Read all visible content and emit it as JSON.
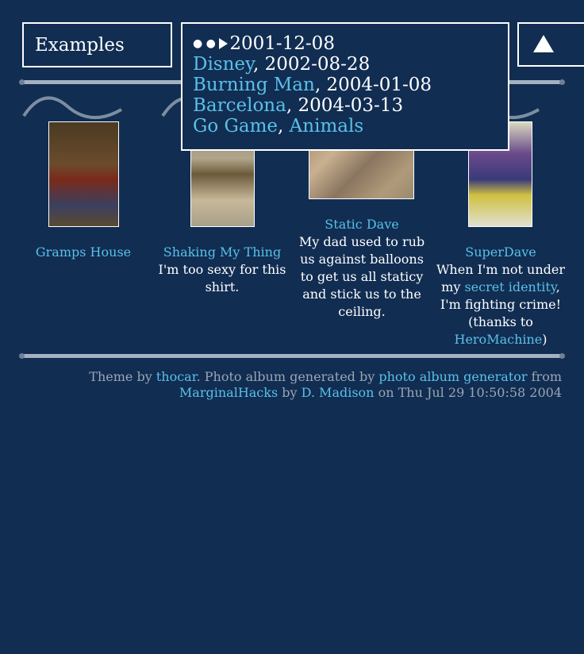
{
  "header": {
    "title": "Examples",
    "current_date": "2001-12-08",
    "nav": [
      {
        "link": "Disney",
        "date": ", 2002-08-28"
      },
      {
        "link": "Burning Man",
        "date": ", 2004-01-08"
      },
      {
        "link": "Barcelona",
        "date": ", 2004-03-13"
      }
    ],
    "other_links": [
      "Go Game",
      "Animals"
    ],
    "up_icon": "up-triangle-icon"
  },
  "albums": [
    {
      "name": "Gramps House",
      "desc": ""
    },
    {
      "name": "Shaking My Thing",
      "desc": "I'm too sexy for this shirt."
    },
    {
      "name": "Static Dave",
      "desc": "My dad used to rub us against balloons to get us all staticy and stick us to the ceiling."
    },
    {
      "name": "SuperDave",
      "desc_pre": "When I'm not under my ",
      "desc_link": "secret identity",
      "desc_mid": ", I'm fighting crime! (thanks to ",
      "desc_link2": "HeroMachine",
      "desc_post": ")"
    }
  ],
  "footer": {
    "t1": "Theme by ",
    "l1": "thocar",
    "t2": ". Photo album generated by ",
    "l2": "photo album generator",
    "t3": " from ",
    "l3": "MarginalHacks",
    "t4": " by ",
    "l4": "D. Madison",
    "t5": " on Thu Jul 29 10:50:58 2004"
  },
  "colors": {
    "background": "#112d52",
    "link": "#5bc0e8",
    "rule": "#a4b2c0"
  }
}
